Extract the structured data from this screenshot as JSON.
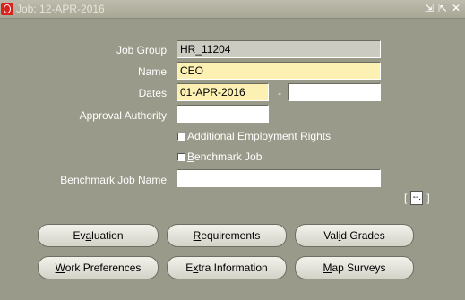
{
  "window": {
    "title": "Job: 12-APR-2016",
    "controls": {
      "minimize": "⇲",
      "maximize": "⇱",
      "close": "✕"
    }
  },
  "form": {
    "job_group": {
      "label": "Job Group",
      "value": "HR_11204"
    },
    "name": {
      "label": "Name",
      "value": "CEO"
    },
    "dates": {
      "label": "Dates",
      "from": "01-APR-2016",
      "separator": "-",
      "to": ""
    },
    "approval_authority": {
      "label": "Approval Authority",
      "value": ""
    },
    "additional_rights": {
      "label_pre": "",
      "mnemonic": "A",
      "label_post": "dditional Employment Rights",
      "checked": false
    },
    "benchmark_job": {
      "label_pre": "",
      "mnemonic": "B",
      "label_post": "enchmark Job",
      "checked": false
    },
    "benchmark_job_name": {
      "label": "Benchmark Job Name",
      "value": ""
    },
    "descriptive_flexfield": {
      "open": "[",
      "value": "--.",
      "close": "]"
    }
  },
  "buttons": {
    "evaluation": {
      "pre": "Ev",
      "mnemonic": "a",
      "post": "luation"
    },
    "requirements": {
      "pre": "",
      "mnemonic": "R",
      "post": "equirements"
    },
    "valid_grades": {
      "pre": "Val",
      "mnemonic": "i",
      "post": "d Grades"
    },
    "work_preferences": {
      "pre": "",
      "mnemonic": "W",
      "post": "ork Preferences"
    },
    "extra_information": {
      "pre": "E",
      "mnemonic": "x",
      "post": "tra Information"
    },
    "map_surveys": {
      "pre": "",
      "mnemonic": "M",
      "post": "ap Surveys"
    }
  },
  "colors": {
    "canvas": "#9a9a8a",
    "required_field": "#fcf1b2",
    "readonly_field": "#cbcbc2",
    "oracle_red": "#d8231d"
  }
}
